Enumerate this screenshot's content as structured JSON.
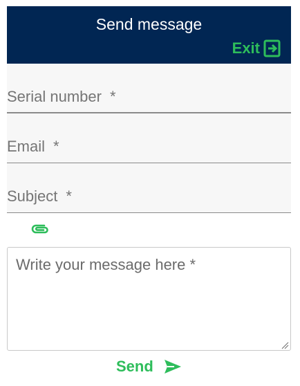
{
  "header": {
    "title": "Send message",
    "exit_label": "Exit"
  },
  "form": {
    "serial": {
      "label": "Serial number",
      "required_mark": "*",
      "value": ""
    },
    "email": {
      "label": "Email",
      "required_mark": "*",
      "value": ""
    },
    "subject": {
      "label": "Subject",
      "required_mark": "*",
      "value": ""
    },
    "message": {
      "placeholder": "Write your message here *",
      "value": ""
    }
  },
  "actions": {
    "send_label": "Send"
  },
  "icons": {
    "exit": "exit-icon",
    "attach": "paperclip-icon",
    "send": "send-arrow-icon",
    "resize": "resize-handle-icon"
  },
  "colors": {
    "header_bg": "#012653",
    "accent_green": "#2ebd5b",
    "field_bg": "#f7f7f7",
    "label_gray": "#757575"
  }
}
